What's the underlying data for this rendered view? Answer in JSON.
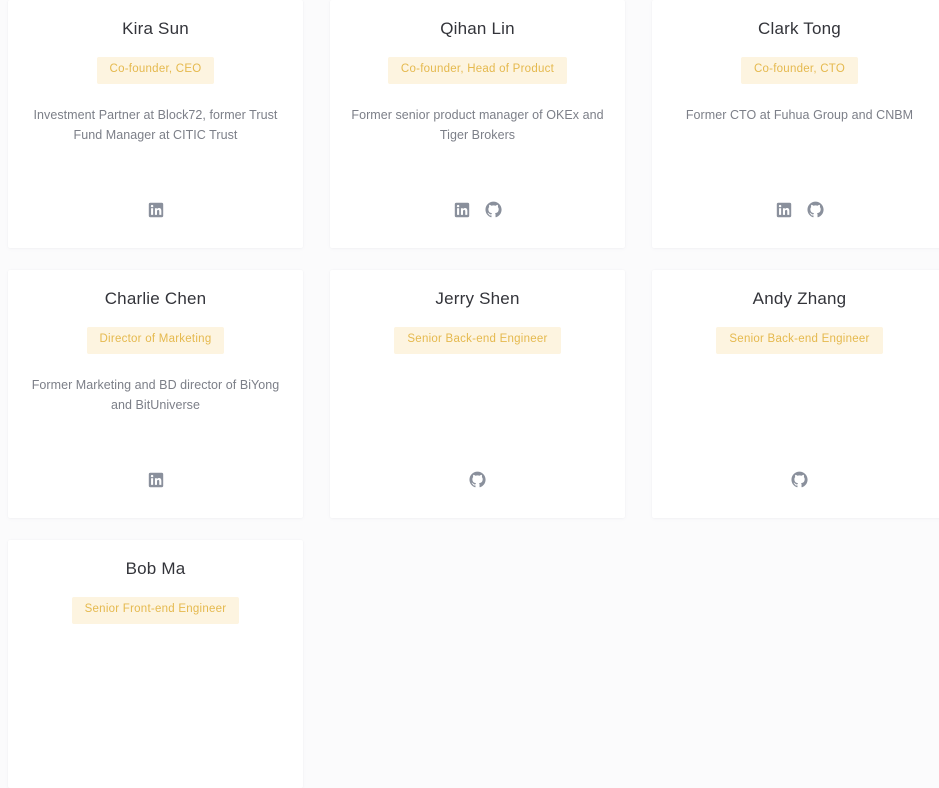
{
  "page": {
    "section_name": "team-members-grid",
    "columns": 3
  },
  "colors": {
    "page_background": "#fbfbfc",
    "card_background": "#ffffff",
    "name_text": "#33343a",
    "badge_background": "#fdf4e0",
    "badge_text": "#e5b94e",
    "bio_text": "#7c7f88",
    "social_icon": "#8a909c"
  },
  "members": [
    {
      "name": "Kira Sun",
      "role": "Co-founder, CEO",
      "bio": "Investment Partner at Block72, former Trust Fund Manager at CITIC Trust",
      "socials": [
        "linkedin-icon"
      ]
    },
    {
      "name": "Qihan Lin",
      "role": "Co-founder, Head of Product",
      "bio": "Former senior product manager of OKEx and Tiger Brokers",
      "socials": [
        "linkedin-icon",
        "github-icon"
      ]
    },
    {
      "name": "Clark Tong",
      "role": "Co-founder, CTO",
      "bio": "Former CTO at Fuhua Group and CNBM",
      "socials": [
        "linkedin-icon",
        "github-icon"
      ]
    },
    {
      "name": "Charlie Chen",
      "role": "Director of Marketing",
      "bio": "Former Marketing and BD director of BiYong and BitUniverse",
      "socials": [
        "linkedin-icon"
      ]
    },
    {
      "name": "Jerry Shen",
      "role": "Senior Back-end Engineer",
      "bio": "",
      "socials": [
        "github-icon"
      ]
    },
    {
      "name": "Andy Zhang",
      "role": "Senior Back-end Engineer",
      "bio": "",
      "socials": [
        "github-icon"
      ]
    },
    {
      "name": "Bob Ma",
      "role": "Senior Front-end Engineer",
      "bio": "",
      "socials": []
    }
  ]
}
